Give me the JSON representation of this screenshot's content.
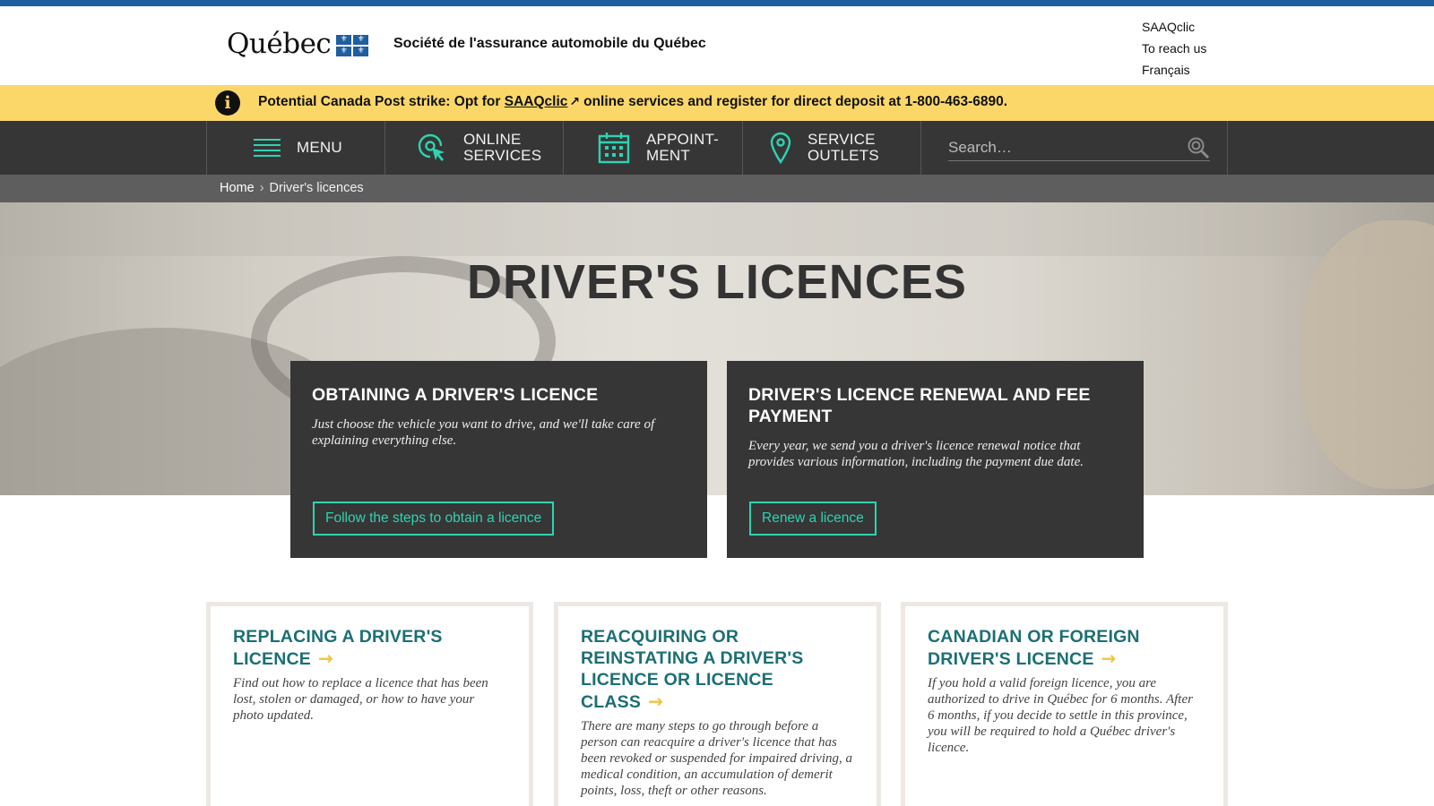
{
  "header": {
    "logo_text": "Québec",
    "org_name": "Société de l'assurance automobile du Québec",
    "top_links": [
      "SAAQclic",
      "To reach us",
      "Français"
    ]
  },
  "alert": {
    "icon": "info-icon",
    "text_before": "Potential Canada Post strike: Opt for ",
    "link_text": "SAAQclic",
    "link_icon": "external-link-icon",
    "text_after": "online services and register for direct deposit at 1-800-463-6890."
  },
  "nav": {
    "menu": {
      "label": "MENU",
      "icon": "hamburger-icon"
    },
    "online_services": {
      "line1": "ONLINE",
      "line2": "SERVICES",
      "icon": "cursor-click-icon"
    },
    "appointment": {
      "line1": "APPOINT-",
      "line2": "MENT",
      "icon": "calendar-icon"
    },
    "service_outlets": {
      "line1": "SERVICE",
      "line2": "OUTLETS",
      "icon": "map-pin-icon"
    },
    "search": {
      "placeholder": "Search…",
      "icon": "search-icon"
    }
  },
  "breadcrumb": {
    "home": "Home",
    "separator": "›",
    "current": "Driver's licences"
  },
  "hero": {
    "title": "DRIVER'S LICENCES"
  },
  "feature_cards": [
    {
      "title": "OBTAINING A DRIVER'S LICENCE",
      "description": "Just choose the vehicle you want to drive, and we'll take care of explaining everything else.",
      "button": "Follow the steps to obtain a licence"
    },
    {
      "title": "DRIVER'S LICENCE RENEWAL AND FEE PAYMENT",
      "description": "Every year, we send you a driver's licence renewal notice that provides various information, including the payment due date.",
      "button": "Renew a licence"
    }
  ],
  "tiles": [
    {
      "title": "REPLACING A DRIVER'S LICENCE",
      "description": "Find out how to replace a licence that has been lost, stolen or damaged, or how to have your photo updated."
    },
    {
      "title": "REACQUIRING OR REINSTATING A DRIVER'S LICENCE OR LICENCE CLASS",
      "description": "There are many steps to go through before a person can reacquire a driver's licence that has been revoked or suspended for impaired driving, a medical condition, an accumulation of demerit points, loss, theft or other reasons."
    },
    {
      "title": "CANADIAN OR FOREIGN DRIVER'S LICENCE",
      "description": "If you hold a valid foreign licence, you are authorized to drive in Québec for 6 months. After 6 months, if you decide to settle in this province, you will be required to hold a Québec driver's licence."
    }
  ],
  "colors": {
    "top_stripe": "#1f5f9e",
    "alert_bg": "#fbd769",
    "nav_bg": "#363636",
    "accent_teal": "#2ed3b2",
    "tile_title": "#1c6f75",
    "arrow_yellow": "#f0c53c"
  }
}
